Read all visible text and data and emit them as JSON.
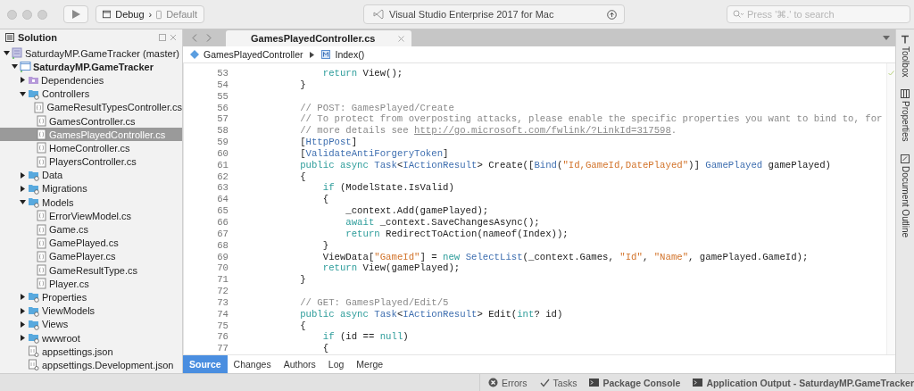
{
  "window": {
    "title": "Visual Studio Enterprise 2017 for Mac"
  },
  "toolbar": {
    "configuration": "Debug",
    "separator": "›",
    "device": "Default",
    "search": {
      "placeholder": "Press '⌘.' to search"
    }
  },
  "solution_pad": {
    "title": "Solution",
    "tree": [
      {
        "label": "SaturdayMP.GameTracker (master)",
        "kind": "solution",
        "expanded": true,
        "selected": false,
        "children": [
          {
            "label": "SaturdayMP.GameTracker",
            "kind": "project",
            "expanded": true,
            "selected": false,
            "children": [
              {
                "label": "Dependencies",
                "kind": "dependencies",
                "expanded": false,
                "selected": false
              },
              {
                "label": "Controllers",
                "kind": "folder",
                "expanded": true,
                "selected": false,
                "children": [
                  {
                    "label": "GameResultTypesController.cs",
                    "kind": "file",
                    "selected": false
                  },
                  {
                    "label": "GamesController.cs",
                    "kind": "file",
                    "selected": false
                  },
                  {
                    "label": "GamesPlayedController.cs",
                    "kind": "file",
                    "selected": true
                  },
                  {
                    "label": "HomeController.cs",
                    "kind": "file",
                    "selected": false
                  },
                  {
                    "label": "PlayersController.cs",
                    "kind": "file",
                    "selected": false
                  }
                ]
              },
              {
                "label": "Data",
                "kind": "folder",
                "expanded": false,
                "selected": false
              },
              {
                "label": "Migrations",
                "kind": "folder",
                "expanded": false,
                "selected": false
              },
              {
                "label": "Models",
                "kind": "folder",
                "expanded": true,
                "selected": false,
                "children": [
                  {
                    "label": "ErrorViewModel.cs",
                    "kind": "file",
                    "selected": false
                  },
                  {
                    "label": "Game.cs",
                    "kind": "file",
                    "selected": false
                  },
                  {
                    "label": "GamePlayed.cs",
                    "kind": "file",
                    "selected": false
                  },
                  {
                    "label": "GamePlayer.cs",
                    "kind": "file",
                    "selected": false
                  },
                  {
                    "label": "GameResultType.cs",
                    "kind": "file",
                    "selected": false
                  },
                  {
                    "label": "Player.cs",
                    "kind": "file",
                    "selected": false
                  }
                ]
              },
              {
                "label": "Properties",
                "kind": "folder",
                "expanded": false,
                "selected": false
              },
              {
                "label": "ViewModels",
                "kind": "folder",
                "expanded": false,
                "selected": false
              },
              {
                "label": "Views",
                "kind": "folder",
                "expanded": false,
                "selected": false
              },
              {
                "label": "wwwroot",
                "kind": "folder",
                "expanded": false,
                "selected": false
              },
              {
                "label": "appsettings.json",
                "kind": "json",
                "selected": false
              },
              {
                "label": "appsettings.Development.json",
                "kind": "json",
                "selected": false
              }
            ]
          }
        ]
      }
    ]
  },
  "editor": {
    "tabs": [
      {
        "label": "GamesPlayedController.cs",
        "selected": true
      }
    ],
    "breadcrumb": [
      {
        "label": "GamesPlayedController",
        "kind": "class"
      },
      {
        "label": "Index()",
        "kind": "method"
      }
    ],
    "lines": [
      {
        "number": "53",
        "segments": [
          {
            "text": "            return",
            "kind": "keyword"
          },
          {
            "text": " View();",
            "kind": "plain"
          }
        ]
      },
      {
        "number": "54",
        "segments": [
          {
            "text": "        }",
            "kind": "plain"
          }
        ]
      },
      {
        "number": "55"
      },
      {
        "number": "56",
        "segments": [
          {
            "text": "        // POST: GamesPlayed/Create",
            "kind": "comment"
          }
        ]
      },
      {
        "number": "57",
        "segments": [
          {
            "text": "        // To protect from overposting attacks, please enable the specific properties you want to bind to, for",
            "kind": "comment"
          }
        ]
      },
      {
        "number": "58",
        "segments": [
          {
            "text": "        // more details see ",
            "kind": "comment"
          },
          {
            "text": "http://go.microsoft.com/fwlink/?LinkId=317598",
            "kind": "link"
          },
          {
            "text": ".",
            "kind": "comment"
          }
        ]
      },
      {
        "number": "59",
        "segments": [
          {
            "text": "        [",
            "kind": "plain"
          },
          {
            "text": "HttpPost",
            "kind": "type"
          },
          {
            "text": "]",
            "kind": "plain"
          }
        ]
      },
      {
        "number": "60",
        "segments": [
          {
            "text": "        [",
            "kind": "plain"
          },
          {
            "text": "ValidateAntiForgeryToken",
            "kind": "type"
          },
          {
            "text": "]",
            "kind": "plain"
          }
        ]
      },
      {
        "number": "61",
        "segments": [
          {
            "text": "        public async",
            "kind": "keyword"
          },
          {
            "text": " Task",
            "kind": "type"
          },
          {
            "text": "<",
            "kind": "plain"
          },
          {
            "text": "IActionResult",
            "kind": "type"
          },
          {
            "text": "> Create([",
            "kind": "plain"
          },
          {
            "text": "Bind",
            "kind": "type"
          },
          {
            "text": "(",
            "kind": "plain"
          },
          {
            "text": "\"Id,GameId,DatePlayed\"",
            "kind": "string"
          },
          {
            "text": ")] ",
            "kind": "plain"
          },
          {
            "text": "GamePlayed",
            "kind": "type"
          },
          {
            "text": " gamePlayed)",
            "kind": "plain"
          }
        ]
      },
      {
        "number": "62",
        "segments": [
          {
            "text": "        {",
            "kind": "plain"
          }
        ]
      },
      {
        "number": "63",
        "segments": [
          {
            "text": "            if",
            "kind": "keyword"
          },
          {
            "text": " (ModelState.IsValid)",
            "kind": "plain"
          }
        ]
      },
      {
        "number": "64",
        "segments": [
          {
            "text": "            {",
            "kind": "plain"
          }
        ]
      },
      {
        "number": "65",
        "segments": [
          {
            "text": "                _context.Add(gamePlayed);",
            "kind": "plain"
          }
        ]
      },
      {
        "number": "66",
        "segments": [
          {
            "text": "                await",
            "kind": "keyword"
          },
          {
            "text": " _context.SaveChangesAsync();",
            "kind": "plain"
          }
        ]
      },
      {
        "number": "67",
        "segments": [
          {
            "text": "                return",
            "kind": "keyword"
          },
          {
            "text": " RedirectToAction(nameof(Index));",
            "kind": "plain"
          }
        ]
      },
      {
        "number": "68",
        "segments": [
          {
            "text": "            }",
            "kind": "plain"
          }
        ]
      },
      {
        "number": "69",
        "segments": [
          {
            "text": "            ViewData[",
            "kind": "plain"
          },
          {
            "text": "\"GameId\"",
            "kind": "string"
          },
          {
            "text": "] = ",
            "kind": "plain"
          },
          {
            "text": "new",
            "kind": "keyword"
          },
          {
            "text": " SelectList",
            "kind": "type"
          },
          {
            "text": "(_context.Games, ",
            "kind": "plain"
          },
          {
            "text": "\"Id\"",
            "kind": "string"
          },
          {
            "text": ", ",
            "kind": "plain"
          },
          {
            "text": "\"Name\"",
            "kind": "string"
          },
          {
            "text": ", gamePlayed.GameId);",
            "kind": "plain"
          }
        ]
      },
      {
        "number": "70",
        "segments": [
          {
            "text": "            return",
            "kind": "keyword"
          },
          {
            "text": " View(gamePlayed);",
            "kind": "plain"
          }
        ]
      },
      {
        "number": "71",
        "segments": [
          {
            "text": "        }",
            "kind": "plain"
          }
        ]
      },
      {
        "number": "72"
      },
      {
        "number": "73",
        "segments": [
          {
            "text": "        // GET: GamesPlayed/Edit/5",
            "kind": "comment"
          }
        ]
      },
      {
        "number": "74",
        "segments": [
          {
            "text": "        public async",
            "kind": "keyword"
          },
          {
            "text": " Task",
            "kind": "type"
          },
          {
            "text": "<",
            "kind": "plain"
          },
          {
            "text": "IActionResult",
            "kind": "type"
          },
          {
            "text": "> Edit(",
            "kind": "plain"
          },
          {
            "text": "int",
            "kind": "keyword"
          },
          {
            "text": "? id)",
            "kind": "plain"
          }
        ]
      },
      {
        "number": "75",
        "segments": [
          {
            "text": "        {",
            "kind": "plain"
          }
        ]
      },
      {
        "number": "76",
        "segments": [
          {
            "text": "            if",
            "kind": "keyword"
          },
          {
            "text": " (id == ",
            "kind": "plain"
          },
          {
            "text": "null",
            "kind": "keyword"
          },
          {
            "text": ")",
            "kind": "plain"
          }
        ]
      },
      {
        "number": "77",
        "segments": [
          {
            "text": "            {",
            "kind": "plain"
          }
        ]
      }
    ],
    "bottom_tabs": [
      {
        "label": "Source",
        "selected": true
      },
      {
        "label": "Changes",
        "selected": false
      },
      {
        "label": "Authors",
        "selected": false
      },
      {
        "label": "Log",
        "selected": false
      },
      {
        "label": "Merge",
        "selected": false
      }
    ]
  },
  "right_pads": [
    {
      "label": "Toolbox",
      "kind": "toolbox"
    },
    {
      "label": "Properties",
      "kind": "properties"
    },
    {
      "label": "Document Outline",
      "kind": "outline"
    }
  ],
  "status_bar": [
    {
      "label": "Errors",
      "kind": "errors"
    },
    {
      "label": "Tasks",
      "kind": "tasks"
    },
    {
      "label": "Package Console",
      "kind": "console"
    },
    {
      "label": "Application Output - SaturdayMP.GameTracker",
      "kind": "console"
    }
  ]
}
